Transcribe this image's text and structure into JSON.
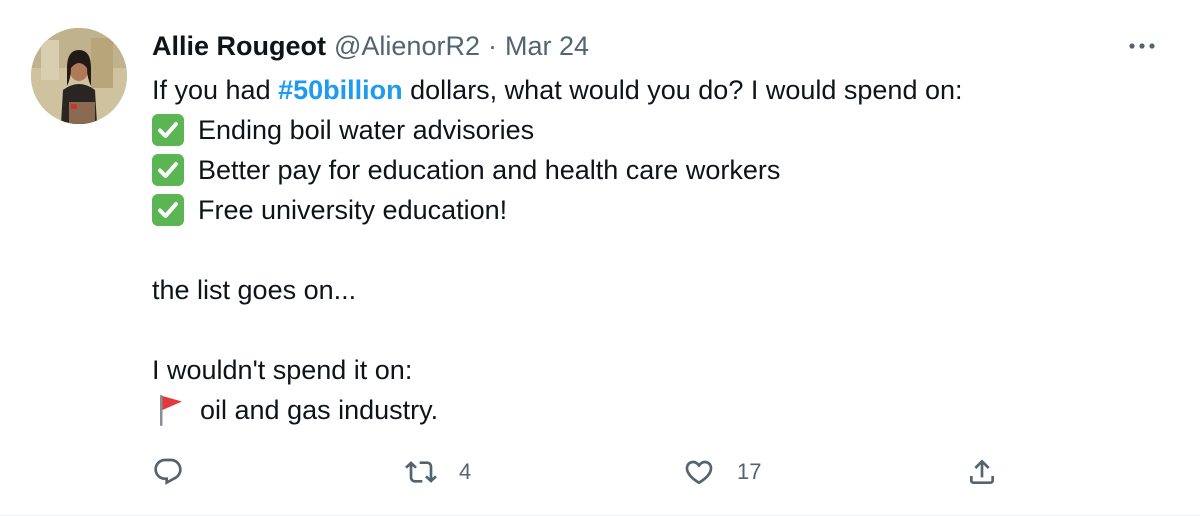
{
  "tweet": {
    "author_name": "Allie Rougeot",
    "author_handle": "@AlienorR2",
    "separator": "·",
    "date": "Mar 24",
    "body": {
      "line1_before": "If you had ",
      "hashtag": "#50billion",
      "line1_after": " dollars, what would you do? I would spend on:",
      "spend_items": [
        "Ending boil water advisories",
        "Better pay for education and health care workers",
        "Free university education!"
      ],
      "continuation": "the list goes on...",
      "wouldnt_line": "I wouldn't spend it on:",
      "not_items": [
        "oil and gas industry."
      ]
    },
    "icons": {
      "spend_item_icon": "check-mark-button-emoji",
      "not_item_icon": "red-flag-emoji",
      "more": "more-options-icon",
      "reply": "reply-icon",
      "retweet": "retweet-icon",
      "like": "heart-icon",
      "share": "share-icon"
    },
    "stats": {
      "retweets": "4",
      "likes": "17"
    },
    "colors": {
      "hashtag": "#1d9bf0",
      "secondary_text": "#536471",
      "check_green": "#5ab552",
      "flag_red": "#e23a3a"
    }
  }
}
